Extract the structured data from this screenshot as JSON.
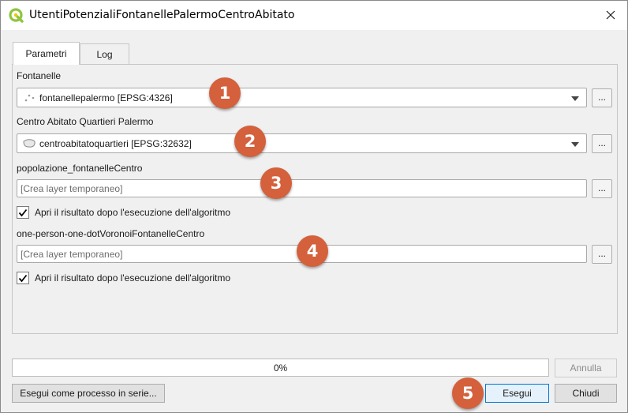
{
  "window": {
    "title": "UtentiPotenzialiFontanellePalermoCentroAbitato",
    "close_glyph": "✕"
  },
  "tabs": [
    {
      "label": "Parametri",
      "active": true
    },
    {
      "label": "Log",
      "active": false
    }
  ],
  "params": {
    "fontanelle": {
      "label": "Fontanelle",
      "value": "fontanellepalermo [EPSG:4326]",
      "icon": "point-layer-icon"
    },
    "centro": {
      "label": "Centro Abitato Quartieri Palermo",
      "value": "centroabitatoquartieri [EPSG:32632]",
      "icon": "polygon-layer-icon"
    },
    "popolazione": {
      "label": "popolazione_fontanelleCentro",
      "placeholder": "[Crea layer temporaneo]"
    },
    "popolazione_open": {
      "label": "Apri il risultato dopo l'esecuzione dell'algoritmo",
      "checked": true
    },
    "voronoi": {
      "label": "one-person-one-dotVoronoiFontanelleCentro",
      "placeholder": "[Crea layer temporaneo]"
    },
    "voronoi_open": {
      "label": "Apri il risultato dopo l'esecuzione dell'algoritmo",
      "checked": true
    },
    "browse_label": "..."
  },
  "badges": [
    "1",
    "2",
    "3",
    "4",
    "5"
  ],
  "progress": {
    "value": 0,
    "text": "0%"
  },
  "buttons": {
    "cancel": "Annulla",
    "batch": "Esegui come processo in serie...",
    "run": "Esegui",
    "close": "Chiudi"
  },
  "colors": {
    "badge": "#d4603c",
    "qgis_green": "#8fc43f",
    "focus_blue": "#0078d7"
  }
}
